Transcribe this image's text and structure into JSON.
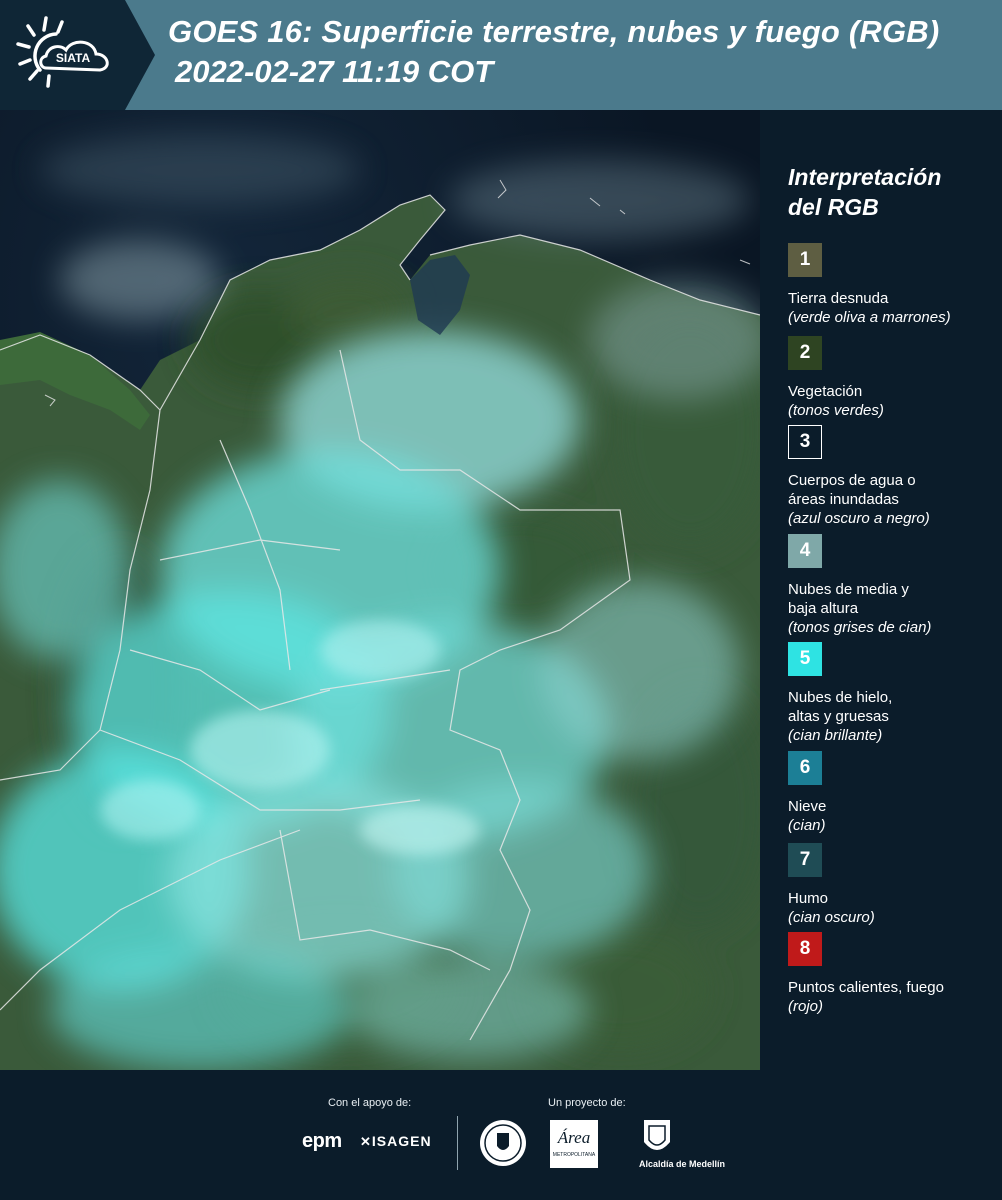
{
  "header": {
    "logo_text": "SIATA",
    "title_line1": "GOES 16: Superficie terrestre, nubes y fuego (RGB)",
    "title_line2": "2022-02-27 11:19 COT"
  },
  "legend": {
    "title_line1": "Interpretación",
    "title_line2": "del RGB",
    "items": [
      {
        "number": "1",
        "color": "#5e5e42",
        "label_lines": [
          "Tierra desnuda"
        ],
        "desc": "(verde oliva a marrones)"
      },
      {
        "number": "2",
        "color": "#2e4422",
        "label_lines": [
          "Vegetación"
        ],
        "desc": "(tonos verdes)"
      },
      {
        "number": "3",
        "color": "#0b1c2a",
        "label_lines": [
          "Cuerpos de agua o",
          "áreas inundadas"
        ],
        "desc": "(azul oscuro a negro)"
      },
      {
        "number": "4",
        "color": "#7fa8a8",
        "label_lines": [
          "Nubes de media y",
          "baja altura"
        ],
        "desc": "(tonos grises de cian)"
      },
      {
        "number": "5",
        "color": "#2ee3e3",
        "label_lines": [
          "Nubes de hielo,",
          "altas y gruesas"
        ],
        "desc": "(cian brillante)"
      },
      {
        "number": "6",
        "color": "#1c7f96",
        "label_lines": [
          "Nieve"
        ],
        "desc": "(cian)"
      },
      {
        "number": "7",
        "color": "#1f4c55",
        "label_lines": [
          "Humo"
        ],
        "desc": "(cian oscuro)"
      },
      {
        "number": "8",
        "color": "#c01a1a",
        "label_lines": [
          "Puntos calientes, fuego"
        ],
        "desc": "(rojo)"
      }
    ]
  },
  "footer": {
    "support_caption": "Con el apoyo de:",
    "project_caption": "Un proyecto de:",
    "epm_logo": "epm",
    "isagen_logo": "ISAGEN",
    "area_logo": "Área",
    "area_sub": "METROPOLITANA",
    "alcaldia_logo": "Alcaldía de Medellín"
  }
}
